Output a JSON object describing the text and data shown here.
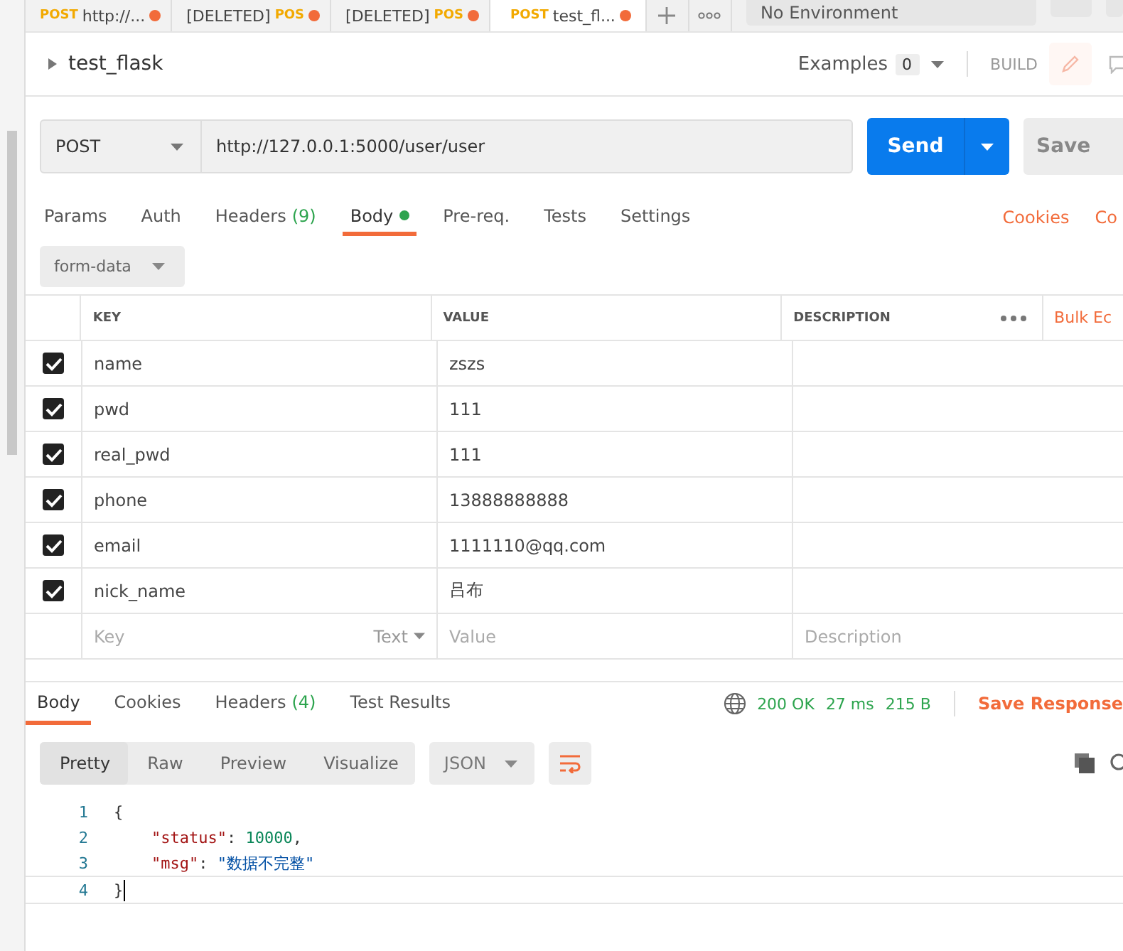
{
  "open_tabs": [
    {
      "method": "POST",
      "name": "http://...",
      "selected": false,
      "unsaved": true
    },
    {
      "name": "[DELETED]",
      "suffix": "POS",
      "selected": false,
      "unsaved": true
    },
    {
      "name": "[DELETED]",
      "suffix": "POS",
      "selected": false,
      "unsaved": true
    },
    {
      "method": "POST",
      "name": "test_fl...",
      "selected": true,
      "unsaved": true
    }
  ],
  "environment": {
    "value": "No Environment"
  },
  "request": {
    "name": "test_flask",
    "examples_label": "Examples",
    "examples_count": "0",
    "build_label": "BUILD",
    "method": "POST",
    "url": "http://127.0.0.1:5000/user/user",
    "send_label": "Send",
    "save_label": "Save"
  },
  "request_tabs": [
    {
      "label": "Params",
      "dot": false,
      "selected": false
    },
    {
      "label": "Auth",
      "dot": false,
      "selected": false
    },
    {
      "label": "Headers",
      "count": "(9)",
      "dot": false,
      "selected": false
    },
    {
      "label": "Body",
      "dot": true,
      "selected": true
    },
    {
      "label": "Pre-req.",
      "dot": false,
      "selected": false
    },
    {
      "label": "Tests",
      "dot": false,
      "selected": false
    },
    {
      "label": "Settings",
      "dot": false,
      "selected": false
    }
  ],
  "request_links": [
    "Cookies",
    "Co"
  ],
  "body_mode": "form-data",
  "table": {
    "columns": [
      "KEY",
      "VALUE",
      "DESCRIPTION"
    ],
    "bulk_edit": "Bulk Ec",
    "rows": [
      {
        "key": "name",
        "value": "zszs",
        "checked": true
      },
      {
        "key": "pwd",
        "value": "111",
        "checked": true
      },
      {
        "key": "real_pwd",
        "value": "111",
        "checked": true
      },
      {
        "key": "phone",
        "value": "13888888888",
        "checked": true
      },
      {
        "key": "email",
        "value": "1111110@qq.com",
        "checked": true
      },
      {
        "key": "nick_name",
        "value": "吕布",
        "checked": true
      }
    ],
    "new_row": {
      "key_placeholder": "Key",
      "type": "Text",
      "value_placeholder": "Value",
      "description_placeholder": "Description"
    }
  },
  "response_tabs": [
    {
      "label": "Body",
      "selected": true
    },
    {
      "label": "Cookies",
      "selected": false
    },
    {
      "label": "Headers",
      "count": "(4)",
      "selected": false
    },
    {
      "label": "Test Results",
      "selected": false
    }
  ],
  "response_status": {
    "status": "200 OK",
    "time": "27 ms",
    "size": "215 B",
    "save_label": "Save Response"
  },
  "view_modes": [
    {
      "label": "Pretty",
      "selected": true
    },
    {
      "label": "Raw",
      "selected": false
    },
    {
      "label": "Preview",
      "selected": false
    },
    {
      "label": "Visualize",
      "selected": false
    }
  ],
  "format": "JSON",
  "code_lines": [
    {
      "number": "1",
      "current": false,
      "tokens": [
        {
          "kind": "punct",
          "text": "{"
        }
      ]
    },
    {
      "number": "2",
      "current": false,
      "indented": true,
      "tokens": [
        {
          "kind": "key",
          "text": "\"status\""
        },
        {
          "kind": "punct",
          "text": ": "
        },
        {
          "kind": "number",
          "text": "10000"
        },
        {
          "kind": "punct",
          "text": ","
        }
      ]
    },
    {
      "number": "3",
      "current": false,
      "indented": true,
      "tokens": [
        {
          "kind": "key",
          "text": "\"msg\""
        },
        {
          "kind": "punct",
          "text": ": "
        },
        {
          "kind": "string",
          "text": "\"数据不完整\""
        }
      ]
    },
    {
      "number": "4",
      "current": true,
      "tokens": [
        {
          "kind": "punct",
          "text": "}"
        }
      ]
    }
  ]
}
